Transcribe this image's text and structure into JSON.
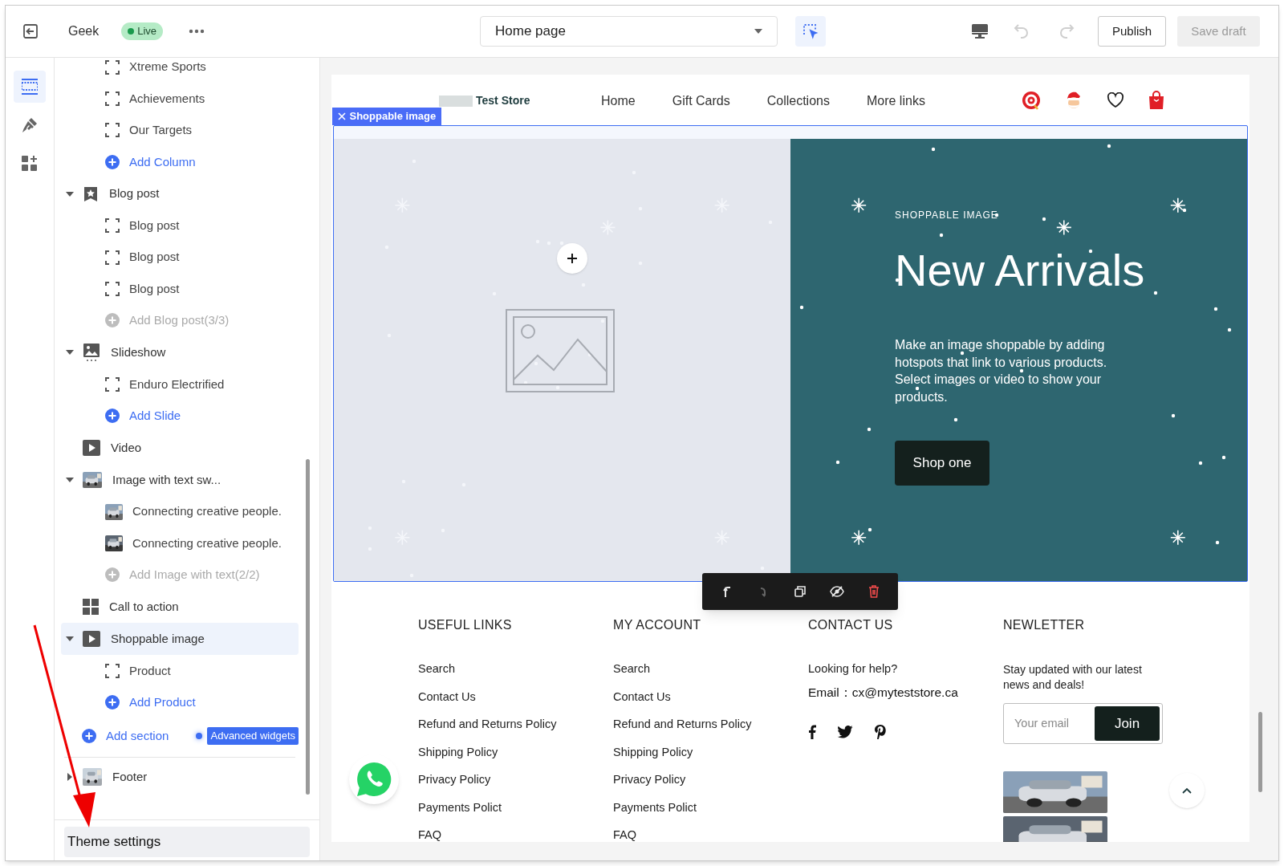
{
  "topbar": {
    "store_name": "Geek",
    "status": "Live",
    "page_select": "Home page",
    "select_tool_active": true,
    "history": [
      {
        "kind": "undo",
        "disabled": true
      },
      {
        "kind": "redo",
        "disabled": true
      }
    ],
    "buttons": [
      {
        "label": "Publish",
        "disabled": false
      },
      {
        "label": "Save draft",
        "disabled": true
      }
    ]
  },
  "rail": [
    {
      "selected": true
    },
    {
      "selected": false
    },
    {
      "selected": false
    }
  ],
  "sidebar": {
    "scrolled_children": [
      {
        "kind": "block",
        "label": "Xtreme Sports"
      },
      {
        "kind": "block",
        "label": "Achievements"
      },
      {
        "kind": "block",
        "label": "Our Targets"
      },
      {
        "kind": "add",
        "label": "Add Column",
        "disabled": false
      }
    ],
    "sections": [
      {
        "kind": "section",
        "label": "Blog post",
        "expanded": true,
        "selected": false,
        "children": [
          {
            "kind": "block",
            "label": "Blog post"
          },
          {
            "kind": "block",
            "label": "Blog post"
          },
          {
            "kind": "block",
            "label": "Blog post"
          },
          {
            "kind": "add",
            "label": "Add Blog post(3/3)",
            "disabled": true
          }
        ]
      },
      {
        "kind": "section",
        "label": "Slideshow",
        "expanded": true,
        "selected": false,
        "children": [
          {
            "kind": "block",
            "label": "Enduro Electrified"
          },
          {
            "kind": "add",
            "label": "Add Slide",
            "disabled": false
          }
        ]
      },
      {
        "kind": "plain",
        "label": "Video",
        "selected": false
      },
      {
        "kind": "section",
        "label": "Image with text sw...",
        "expanded": true,
        "selected": false,
        "children": [
          {
            "kind": "thumb",
            "label": "Connecting creative people."
          },
          {
            "kind": "thumb",
            "label": "Connecting creative people."
          },
          {
            "kind": "add",
            "label": "Add Image with text(2/2)",
            "disabled": true
          }
        ]
      },
      {
        "kind": "plain",
        "label": "Call to action",
        "selected": false
      },
      {
        "kind": "section",
        "label": "Shoppable image",
        "expanded": true,
        "selected": true,
        "children": [
          {
            "kind": "block",
            "label": "Product"
          },
          {
            "kind": "add",
            "label": "Add Product",
            "disabled": false
          }
        ]
      }
    ],
    "add_section": "Add section",
    "badge": "Advanced widgets",
    "footer_section": {
      "label": "Footer",
      "expanded": false,
      "selected": false
    },
    "theme_settings": "Theme settings"
  },
  "preview": {
    "store": {
      "name": "Test Store",
      "nav": [
        "Home",
        "Gift Cards",
        "Collections",
        "More links"
      ]
    },
    "selection_tag": "Shoppable image",
    "hero": {
      "eyebrow": "SHOPPABLE IMAGE",
      "title": "New Arrivals",
      "text": "Make an image shoppable by adding hotspots that link to various products. Select images or video to show your products.",
      "button": "Shop one"
    },
    "toolbar": [
      {
        "kind": "move_up",
        "disabled": false
      },
      {
        "kind": "move_down",
        "disabled": true
      },
      {
        "kind": "duplicate",
        "disabled": false
      },
      {
        "kind": "hide",
        "disabled": false
      },
      {
        "kind": "delete",
        "disabled": false
      }
    ],
    "footer": {
      "columns": [
        {
          "heading": "USEFUL LINKS",
          "links": [
            "Search",
            "Contact Us",
            "Refund and Returns Policy",
            "Shipping Policy",
            "Privacy Policy",
            "Payments Polict",
            "FAQ"
          ]
        },
        {
          "heading": "MY ACCOUNT",
          "links": [
            "Search",
            "Contact Us",
            "Refund and Returns Policy",
            "Shipping Policy",
            "Privacy Policy",
            "Payments Polict",
            "FAQ"
          ]
        }
      ],
      "contact": {
        "heading": "CONTACT US",
        "help": "Looking for help?",
        "email_label": "Email：",
        "email": "cx@myteststore.ca"
      },
      "newsletter": {
        "heading": "NEWLETTER",
        "text": "Stay updated with our latest news and deals!",
        "placeholder": "Your email",
        "button": "Join"
      }
    }
  }
}
